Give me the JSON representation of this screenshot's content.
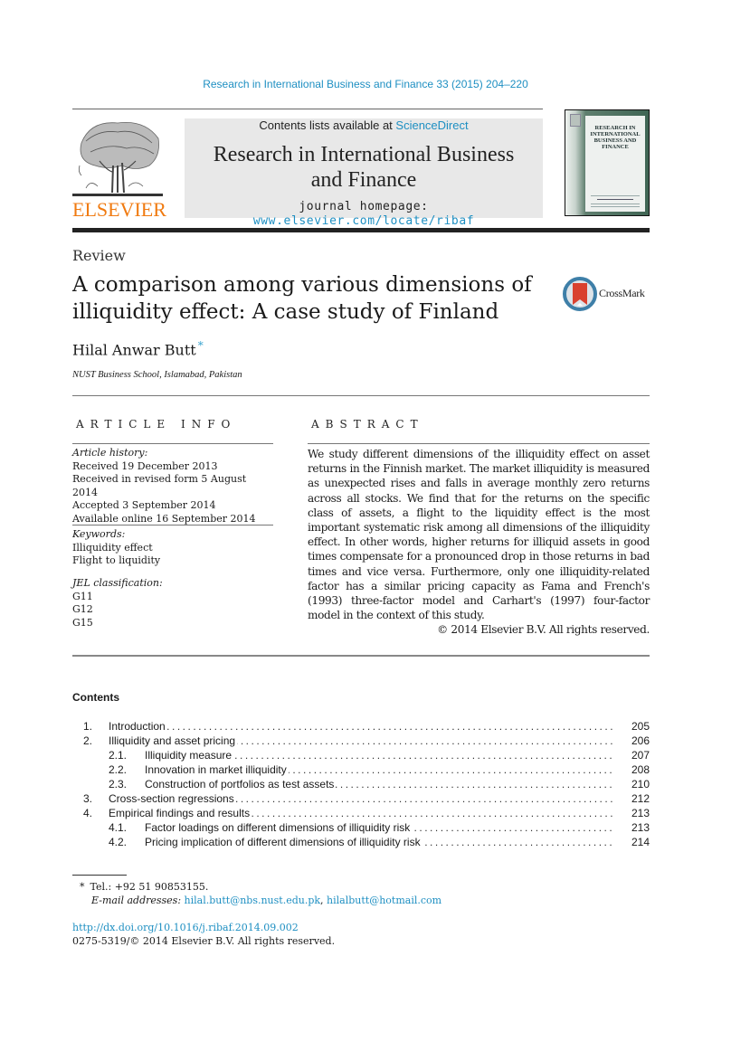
{
  "journal_ref": "Research in International Business and Finance 33 (2015) 204–220",
  "header": {
    "publisher_logo_text": "ELSEVIER",
    "contents_available_prefix": "Contents lists available at ",
    "contents_available_link": "ScienceDirect",
    "journal_title_line1": "Research in International Business",
    "journal_title_line2": "and Finance",
    "homepage_prefix": "journal homepage: ",
    "homepage_link": "www.elsevier.com/locate/ribaf",
    "cover_title": "RESEARCH IN INTERNATIONAL BUSINESS AND FINANCE"
  },
  "article": {
    "type": "Review",
    "title": "A comparison among various dimensions of illiquidity effect: A case study of Finland",
    "author": "Hilal Anwar Butt",
    "author_marker": "*",
    "affiliation": "NUST Business School, Islamabad, Pakistan",
    "crossmark_label": "CrossMark"
  },
  "article_info": {
    "heading": "ARTICLE INFO",
    "history_label": "Article history:",
    "history": [
      "Received 19 December 2013",
      "Received in revised form 5 August 2014",
      "Accepted 3 September 2014",
      "Available online 16 September 2014"
    ],
    "keywords_label": "Keywords:",
    "keywords": [
      "Illiquidity effect",
      "Flight to liquidity"
    ],
    "jel_label": "JEL classification:",
    "jel": [
      "G11",
      "G12",
      "G15"
    ]
  },
  "abstract": {
    "heading": "ABSTRACT",
    "text": "We study different dimensions of the illiquidity effect on asset returns in the Finnish market. The market illiquidity is measured as unexpected rises and falls in average monthly zero returns across all stocks. We find that for the returns on the specific class of assets, a flight to the liquidity effect is the most important systematic risk among all dimensions of the illiquidity effect. In other words, higher returns for illiquid assets in good times compensate for a pronounced drop in those returns in bad times and vice versa. Furthermore, only one illiquidity-related factor has a similar pricing capacity as Fama and French's (1993) three-factor model and Carhart's (1997) four-factor model in the context of this study.",
    "copyright": "© 2014 Elsevier B.V. All rights reserved."
  },
  "contents": {
    "heading": "Contents",
    "items": [
      {
        "num": "1.",
        "title": "Introduction",
        "page": "205",
        "level": 1
      },
      {
        "num": "2.",
        "title": "Illiquidity and asset pricing",
        "page": "206",
        "level": 1
      },
      {
        "num": "2.1.",
        "title": "Illiquidity measure",
        "page": "207",
        "level": 2
      },
      {
        "num": "2.2.",
        "title": "Innovation in market illiquidity",
        "page": "208",
        "level": 2
      },
      {
        "num": "2.3.",
        "title": "Construction of portfolios as test assets",
        "page": "210",
        "level": 2
      },
      {
        "num": "3.",
        "title": "Cross-section regressions",
        "page": "212",
        "level": 1
      },
      {
        "num": "4.",
        "title": "Empirical findings and results",
        "page": "213",
        "level": 1
      },
      {
        "num": "4.1.",
        "title": "Factor loadings on different dimensions of illiquidity risk",
        "page": "213",
        "level": 2
      },
      {
        "num": "4.2.",
        "title": "Pricing implication of different dimensions of illiquidity risk",
        "page": "214",
        "level": 2
      }
    ]
  },
  "footnote": {
    "marker": "*",
    "tel": "Tel.: +92 51 90853155.",
    "email_label": "E-mail addresses:",
    "email1": "hilal.butt@nbs.nust.edu.pk",
    "email_sep": ", ",
    "email2": "hilalbutt@hotmail.com"
  },
  "doi": {
    "link": "http://dx.doi.org/10.1016/j.ribaf.2014.09.002",
    "issn_line": "0275-5319/© 2014 Elsevier B.V. All rights reserved."
  },
  "colors": {
    "link": "#1e8fc2",
    "elsevier_orange": "#f07a10",
    "header_box": "#e8e8e8"
  }
}
